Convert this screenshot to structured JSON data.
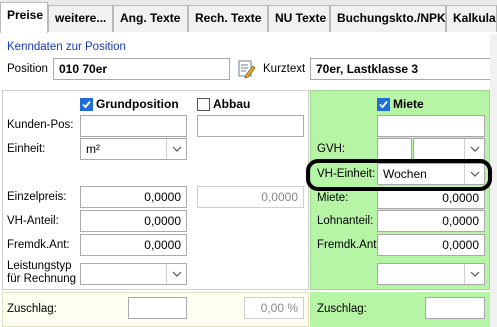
{
  "tabs": [
    {
      "label": "Preise",
      "active": true
    },
    {
      "label": "weitere...",
      "active": false
    },
    {
      "label": "Ang. Texte",
      "active": false
    },
    {
      "label": "Rech. Texte",
      "active": false
    },
    {
      "label": "NU Texte",
      "active": false
    },
    {
      "label": "Buchungskto./NPK",
      "active": false
    },
    {
      "label": "Kalkulati",
      "active": false
    }
  ],
  "kenndaten": {
    "title": "Kenndaten zur Position",
    "position_label": "Position",
    "position_value": "010 70er",
    "kurztext_label": "Kurztext",
    "kurztext_value": "70er, Lastklasse 3"
  },
  "columns": {
    "grundposition": {
      "label": "Grundposition",
      "checked": true
    },
    "abbau": {
      "label": "Abbau",
      "checked": false
    },
    "miete": {
      "label": "Miete",
      "checked": true
    }
  },
  "left": {
    "kunden_pos_label": "Kunden-Pos:",
    "einheit_label": "Einheit:",
    "einheit_value": "m²",
    "einzelpreis_label": "Einzelpreis:",
    "einzelpreis_value": "0,0000",
    "abbau_einzelpreis_value": "0,0000",
    "vh_anteil_label": "VH-Anteil:",
    "vh_anteil_value": "0,0000",
    "fremdk_label": "Fremdk.Ant:",
    "fremdk_value": "0,0000",
    "leistungstyp_label_1": "Leistungstyp",
    "leistungstyp_label_2": "für Rechnung",
    "zuschlag_label": "Zuschlag:",
    "zuschlag_percent": "0,00 %"
  },
  "right": {
    "gvh_label": "GVH:",
    "vh_einheit_label": "VH-Einheit:",
    "vh_einheit_value": "Wochen",
    "miete_label": "Miete:",
    "miete_value": "0,0000",
    "lohnanteil_label": "Lohnanteil:",
    "lohnanteil_value": "0,0000",
    "fremdk_label": "Fremdk.Ant:",
    "fremdk_value": "0,0000",
    "zuschlag_label": "Zuschlag:"
  },
  "colors": {
    "green_panel": "#b7f5a6",
    "accent_blue": "#1a39b6",
    "check_blue": "#1f6fd6"
  },
  "icons": {
    "edit": "edit-document-icon",
    "dropdown": "chevron-down-icon",
    "check": "checkmark-icon"
  }
}
